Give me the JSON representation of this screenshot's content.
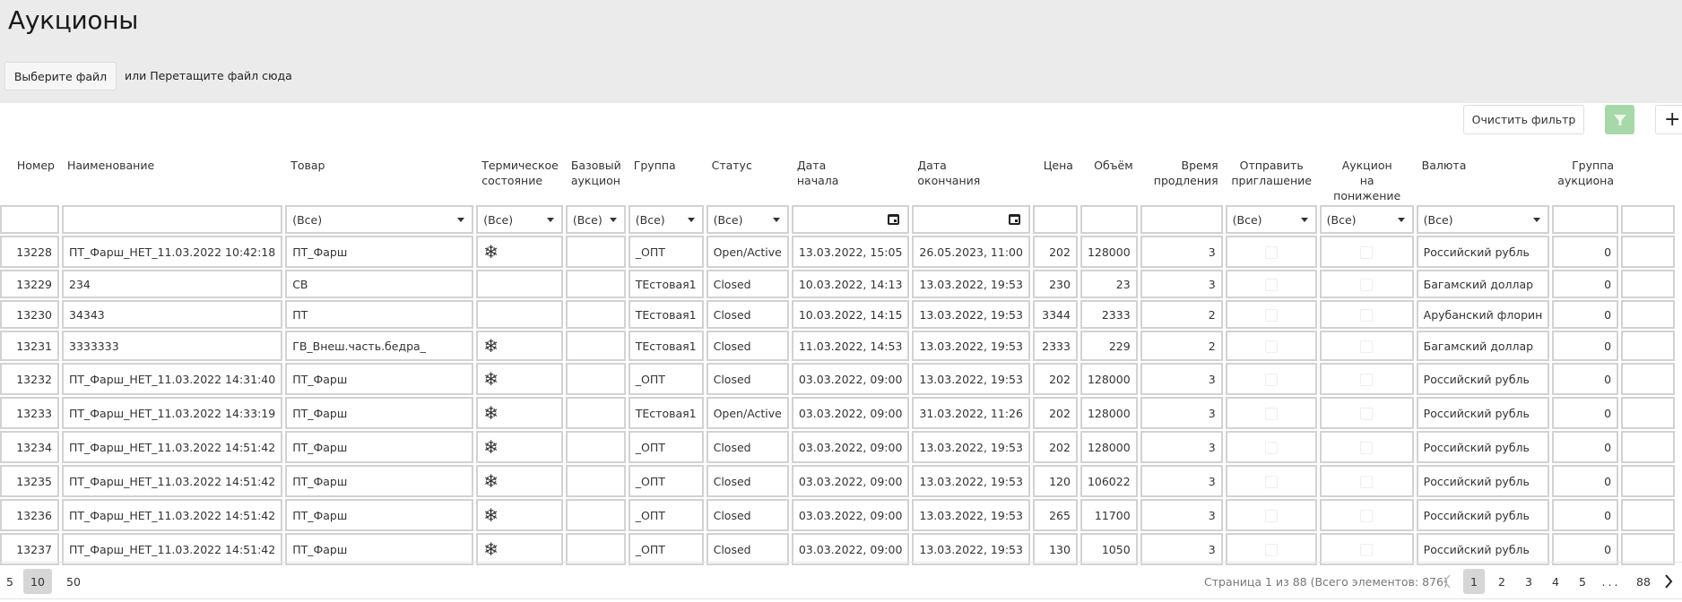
{
  "page": {
    "title": "Аукционы",
    "file_button": "Выберите файл",
    "drop_text": "или Перетащите файл сюда"
  },
  "toolbar": {
    "clear_filter": "Очистить фильтр",
    "filter_icon": "filter-icon",
    "add_label": "+",
    "accent": "#a7d8a9"
  },
  "columns": [
    {
      "key": "number",
      "label": "Номер",
      "align": "r",
      "filter": "text"
    },
    {
      "key": "name",
      "label": "Наименование",
      "align": "l",
      "filter": "text"
    },
    {
      "key": "product",
      "label": "Товар",
      "align": "l",
      "filter": "select"
    },
    {
      "key": "thermal",
      "label": "Термическое\nсостояние",
      "align": "l",
      "filter": "select"
    },
    {
      "key": "base",
      "label": "Базовый\nаукцион",
      "align": "l",
      "filter": "select"
    },
    {
      "key": "group",
      "label": "Группа",
      "align": "l",
      "filter": "select"
    },
    {
      "key": "status",
      "label": "Статус",
      "align": "l",
      "filter": "select"
    },
    {
      "key": "start",
      "label": "Дата\nначала",
      "align": "l",
      "filter": "date"
    },
    {
      "key": "end",
      "label": "Дата\nокончания",
      "align": "l",
      "filter": "date"
    },
    {
      "key": "price",
      "label": "Цена",
      "align": "r",
      "filter": "text"
    },
    {
      "key": "volume",
      "label": "Объём",
      "align": "r",
      "filter": "text"
    },
    {
      "key": "ext",
      "label": "Время\nпродления",
      "align": "r",
      "filter": "text"
    },
    {
      "key": "invite",
      "label": "Отправить\nприглашение",
      "align": "c",
      "filter": "select"
    },
    {
      "key": "down",
      "label": "Аукцион\nна понижение",
      "align": "c",
      "filter": "select"
    },
    {
      "key": "currency",
      "label": "Валюта",
      "align": "l",
      "filter": "select"
    },
    {
      "key": "agroup",
      "label": "Группа\nаукциона",
      "align": "r",
      "filter": "text"
    },
    {
      "key": "extra",
      "label": "",
      "align": "l",
      "filter": "text"
    }
  ],
  "filter_all_label": "(Все)",
  "rows": [
    {
      "number": "13228",
      "name": "ПТ_Фарш_НЕТ_11.03.2022 10:42:18",
      "product": "ПТ_Фарш",
      "thermal": "frozen",
      "base": "",
      "group": "_ОПТ",
      "status": "Open/Active",
      "start": "13.03.2022, 15:05",
      "end": "26.05.2023, 11:00",
      "price": "202",
      "volume": "128000",
      "ext": "3",
      "invite": false,
      "down": false,
      "currency": "Российский рубль",
      "agroup": "0"
    },
    {
      "number": "13229",
      "name": "234",
      "product": "СВ",
      "thermal": "",
      "base": "",
      "group": "ТЕстовая1",
      "status": "Closed",
      "start": "10.03.2022, 14:13",
      "end": "13.03.2022, 19:53",
      "price": "230",
      "volume": "23",
      "ext": "3",
      "invite": false,
      "down": false,
      "currency": "Багамский доллар",
      "agroup": "0"
    },
    {
      "number": "13230",
      "name": "34343",
      "product": "ПТ",
      "thermal": "",
      "base": "",
      "group": "ТЕстовая1",
      "status": "Closed",
      "start": "10.03.2022, 14:15",
      "end": "13.03.2022, 19:53",
      "price": "3344",
      "volume": "2333",
      "ext": "2",
      "invite": false,
      "down": false,
      "currency": "Арубанский флорин",
      "agroup": "0"
    },
    {
      "number": "13231",
      "name": "3333333",
      "product": "ГВ_Внеш.часть.бедра_",
      "thermal": "frozen",
      "base": "",
      "group": "ТЕстовая1",
      "status": "Closed",
      "start": "11.03.2022, 14:53",
      "end": "13.03.2022, 19:53",
      "price": "2333",
      "volume": "229",
      "ext": "2",
      "invite": false,
      "down": false,
      "currency": "Багамский доллар",
      "agroup": "0"
    },
    {
      "number": "13232",
      "name": "ПТ_Фарш_НЕТ_11.03.2022 14:31:40",
      "product": "ПТ_Фарш",
      "thermal": "frozen",
      "base": "",
      "group": "_ОПТ",
      "status": "Closed",
      "start": "03.03.2022, 09:00",
      "end": "13.03.2022, 19:53",
      "price": "202",
      "volume": "128000",
      "ext": "3",
      "invite": false,
      "down": false,
      "currency": "Российский рубль",
      "agroup": "0"
    },
    {
      "number": "13233",
      "name": "ПТ_Фарш_НЕТ_11.03.2022 14:33:19",
      "product": "ПТ_Фарш",
      "thermal": "frozen",
      "base": "",
      "group": "ТЕстовая1",
      "status": "Open/Active",
      "start": "03.03.2022, 09:00",
      "end": "31.03.2022, 11:26",
      "price": "202",
      "volume": "128000",
      "ext": "3",
      "invite": false,
      "down": false,
      "currency": "Российский рубль",
      "agroup": "0"
    },
    {
      "number": "13234",
      "name": "ПТ_Фарш_НЕТ_11.03.2022 14:51:42",
      "product": "ПТ_Фарш",
      "thermal": "frozen",
      "base": "",
      "group": "_ОПТ",
      "status": "Closed",
      "start": "03.03.2022, 09:00",
      "end": "13.03.2022, 19:53",
      "price": "202",
      "volume": "128000",
      "ext": "3",
      "invite": false,
      "down": false,
      "currency": "Российский рубль",
      "agroup": "0"
    },
    {
      "number": "13235",
      "name": "ПТ_Фарш_НЕТ_11.03.2022 14:51:42",
      "product": "ПТ_Фарш",
      "thermal": "frozen",
      "base": "",
      "group": "_ОПТ",
      "status": "Closed",
      "start": "03.03.2022, 09:00",
      "end": "13.03.2022, 19:53",
      "price": "120",
      "volume": "106022",
      "ext": "3",
      "invite": false,
      "down": false,
      "currency": "Российский рубль",
      "agroup": "0"
    },
    {
      "number": "13236",
      "name": "ПТ_Фарш_НЕТ_11.03.2022 14:51:42",
      "product": "ПТ_Фарш",
      "thermal": "frozen",
      "base": "",
      "group": "_ОПТ",
      "status": "Closed",
      "start": "03.03.2022, 09:00",
      "end": "13.03.2022, 19:53",
      "price": "265",
      "volume": "11700",
      "ext": "3",
      "invite": false,
      "down": false,
      "currency": "Российский рубль",
      "agroup": "0"
    },
    {
      "number": "13237",
      "name": "ПТ_Фарш_НЕТ_11.03.2022 14:51:42",
      "product": "ПТ_Фарш",
      "thermal": "frozen",
      "base": "",
      "group": "_ОПТ",
      "status": "Closed",
      "start": "03.03.2022, 09:00",
      "end": "13.03.2022, 19:53",
      "price": "130",
      "volume": "1050",
      "ext": "3",
      "invite": false,
      "down": false,
      "currency": "Российский рубль",
      "agroup": "0"
    }
  ],
  "pager": {
    "sizes": [
      "5",
      "10",
      "50"
    ],
    "selected_size": "10",
    "info": "Страница 1 из 88 (Всего элементов: 876)",
    "pages": [
      "1",
      "2",
      "3",
      "4",
      "5",
      "...",
      "88"
    ],
    "current_page": "1",
    "prev_icon": "chevron-left-icon",
    "next_icon": "chevron-right-icon"
  }
}
